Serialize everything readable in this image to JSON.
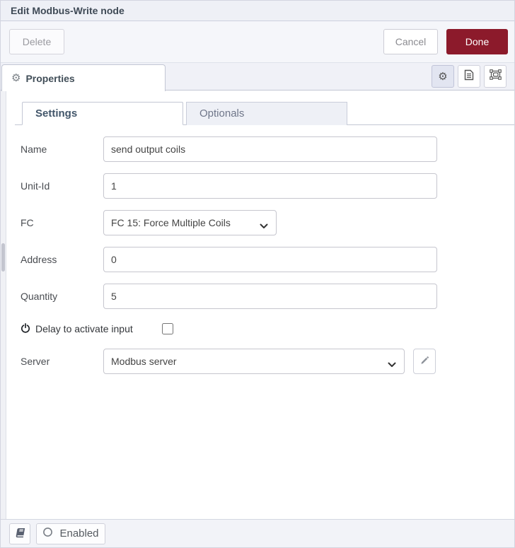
{
  "dialog": {
    "title": "Edit Modbus-Write node",
    "buttons": {
      "delete": "Delete",
      "cancel": "Cancel",
      "done": "Done"
    }
  },
  "editor_tabs": {
    "properties_label": "Properties",
    "icon_buttons": [
      {
        "icon": "gear-icon",
        "selected": true
      },
      {
        "icon": "document-icon",
        "selected": false
      },
      {
        "icon": "appearance-icon",
        "selected": false
      }
    ]
  },
  "subtabs": [
    {
      "label": "Settings",
      "active": true
    },
    {
      "label": "Optionals",
      "active": false
    }
  ],
  "form": {
    "fields": [
      {
        "label": "Name",
        "value": "send output coils",
        "type": "text"
      },
      {
        "label": "Unit-Id",
        "value": "1",
        "type": "text"
      },
      {
        "label": "FC",
        "value": "FC 15: Force Multiple Coils",
        "type": "select"
      },
      {
        "label": "Address",
        "value": "0",
        "type": "text"
      },
      {
        "label": "Quantity",
        "value": "5",
        "type": "text"
      },
      {
        "label": "Server",
        "value": "Modbus server",
        "type": "select"
      }
    ],
    "delay_checkbox": {
      "label": "Delay to activate input",
      "checked": false
    }
  },
  "footer": {
    "enabled_label": "Enabled"
  },
  "colors": {
    "done_button": "#8c1a2b",
    "panel_bg": "#f0f1f7",
    "active_tab_text": "#42566a",
    "border": "#c3c7d4"
  }
}
